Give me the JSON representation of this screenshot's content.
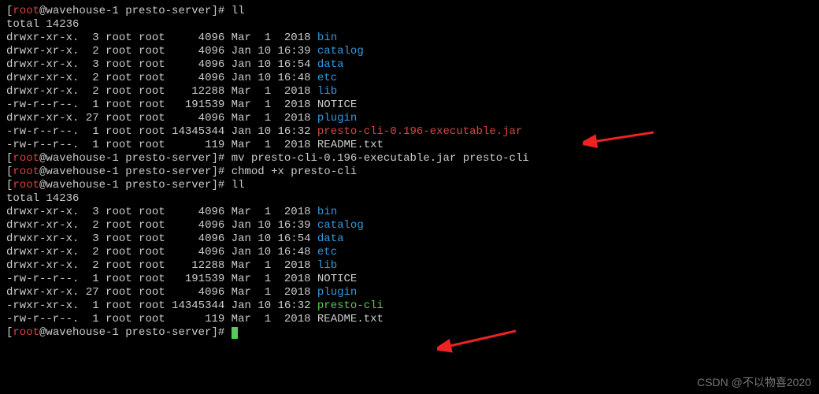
{
  "prompt": {
    "open": "[",
    "user": "root",
    "at": "@",
    "host": "wavehouse-1",
    "path": " presto-server",
    "close": "]# "
  },
  "cmds": {
    "ll": "ll",
    "mv": "mv presto-cli-0.196-executable.jar presto-cli",
    "chmod": "chmod +x presto-cli"
  },
  "total": "total 14236",
  "rows1": [
    {
      "perm": "drwxr-xr-x.",
      "lnk": "  3",
      "own": " root root",
      "size": "     4096",
      "date": " Mar  1  2018 ",
      "name": "bin",
      "cls": "blue"
    },
    {
      "perm": "drwxr-xr-x.",
      "lnk": "  2",
      "own": " root root",
      "size": "     4096",
      "date": " Jan 10 16:39 ",
      "name": "catalog",
      "cls": "blue"
    },
    {
      "perm": "drwxr-xr-x.",
      "lnk": "  3",
      "own": " root root",
      "size": "     4096",
      "date": " Jan 10 16:54 ",
      "name": "data",
      "cls": "blue"
    },
    {
      "perm": "drwxr-xr-x.",
      "lnk": "  2",
      "own": " root root",
      "size": "     4096",
      "date": " Jan 10 16:48 ",
      "name": "etc",
      "cls": "blue"
    },
    {
      "perm": "drwxr-xr-x.",
      "lnk": "  2",
      "own": " root root",
      "size": "    12288",
      "date": " Mar  1  2018 ",
      "name": "lib",
      "cls": "blue"
    },
    {
      "perm": "-rw-r--r--.",
      "lnk": "  1",
      "own": " root root",
      "size": "   191539",
      "date": " Mar  1  2018 ",
      "name": "NOTICE",
      "cls": "white"
    },
    {
      "perm": "drwxr-xr-x.",
      "lnk": " 27",
      "own": " root root",
      "size": "     4096",
      "date": " Mar  1  2018 ",
      "name": "plugin",
      "cls": "blue"
    },
    {
      "perm": "-rw-r--r--.",
      "lnk": "  1",
      "own": " root root",
      "size": " 14345344",
      "date": " Jan 10 16:32 ",
      "name": "presto-cli-0.196-executable.jar",
      "cls": "red"
    },
    {
      "perm": "-rw-r--r--.",
      "lnk": "  1",
      "own": " root root",
      "size": "      119",
      "date": " Mar  1  2018 ",
      "name": "README.txt",
      "cls": "white"
    }
  ],
  "rows2": [
    {
      "perm": "drwxr-xr-x.",
      "lnk": "  3",
      "own": " root root",
      "size": "     4096",
      "date": " Mar  1  2018 ",
      "name": "bin",
      "cls": "blue"
    },
    {
      "perm": "drwxr-xr-x.",
      "lnk": "  2",
      "own": " root root",
      "size": "     4096",
      "date": " Jan 10 16:39 ",
      "name": "catalog",
      "cls": "blue"
    },
    {
      "perm": "drwxr-xr-x.",
      "lnk": "  3",
      "own": " root root",
      "size": "     4096",
      "date": " Jan 10 16:54 ",
      "name": "data",
      "cls": "blue"
    },
    {
      "perm": "drwxr-xr-x.",
      "lnk": "  2",
      "own": " root root",
      "size": "     4096",
      "date": " Jan 10 16:48 ",
      "name": "etc",
      "cls": "blue"
    },
    {
      "perm": "drwxr-xr-x.",
      "lnk": "  2",
      "own": " root root",
      "size": "    12288",
      "date": " Mar  1  2018 ",
      "name": "lib",
      "cls": "blue"
    },
    {
      "perm": "-rw-r--r--.",
      "lnk": "  1",
      "own": " root root",
      "size": "   191539",
      "date": " Mar  1  2018 ",
      "name": "NOTICE",
      "cls": "white"
    },
    {
      "perm": "drwxr-xr-x.",
      "lnk": " 27",
      "own": " root root",
      "size": "     4096",
      "date": " Mar  1  2018 ",
      "name": "plugin",
      "cls": "blue"
    },
    {
      "perm": "-rwxr-xr-x.",
      "lnk": "  1",
      "own": " root root",
      "size": " 14345344",
      "date": " Jan 10 16:32 ",
      "name": "presto-cli",
      "cls": "green"
    },
    {
      "perm": "-rw-r--r--.",
      "lnk": "  1",
      "own": " root root",
      "size": "      119",
      "date": " Mar  1  2018 ",
      "name": "README.txt",
      "cls": "white"
    }
  ],
  "watermark": "CSDN @不以物喜2020"
}
